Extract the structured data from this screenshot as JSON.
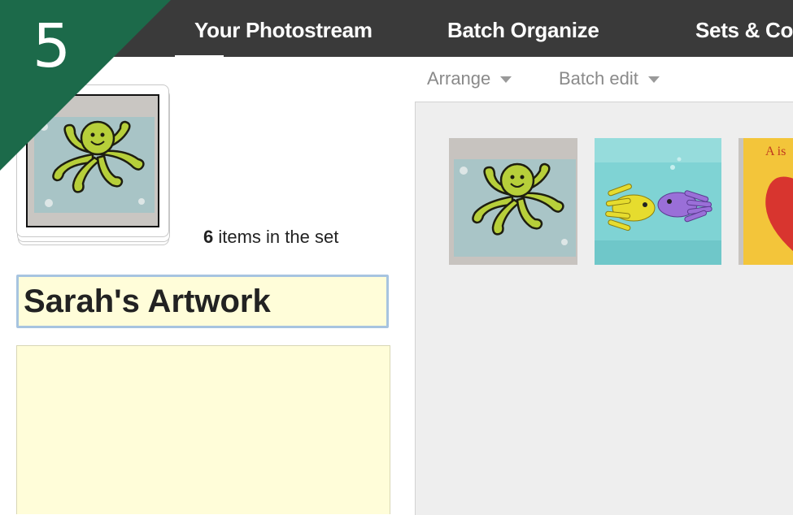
{
  "step": {
    "number": "5",
    "color": "#1c6a4a"
  },
  "nav": {
    "items": [
      "Your Photostream",
      "Batch Organize",
      "Sets & Co"
    ],
    "active": "Your Photostream",
    "bar_color": "#3a3a3a"
  },
  "toolbar": {
    "arrange_label": "Arrange",
    "batch_edit_label": "Batch edit",
    "caret_icon": "caret-down-icon"
  },
  "set": {
    "count": "6",
    "count_suffix": " items in the set",
    "title": "Sarah's Artwork",
    "description": ""
  },
  "tray": {
    "photos": [
      "octopus-painting",
      "handprint-fish-painting",
      "red-heart-painting"
    ],
    "heart_caption": "A is"
  }
}
